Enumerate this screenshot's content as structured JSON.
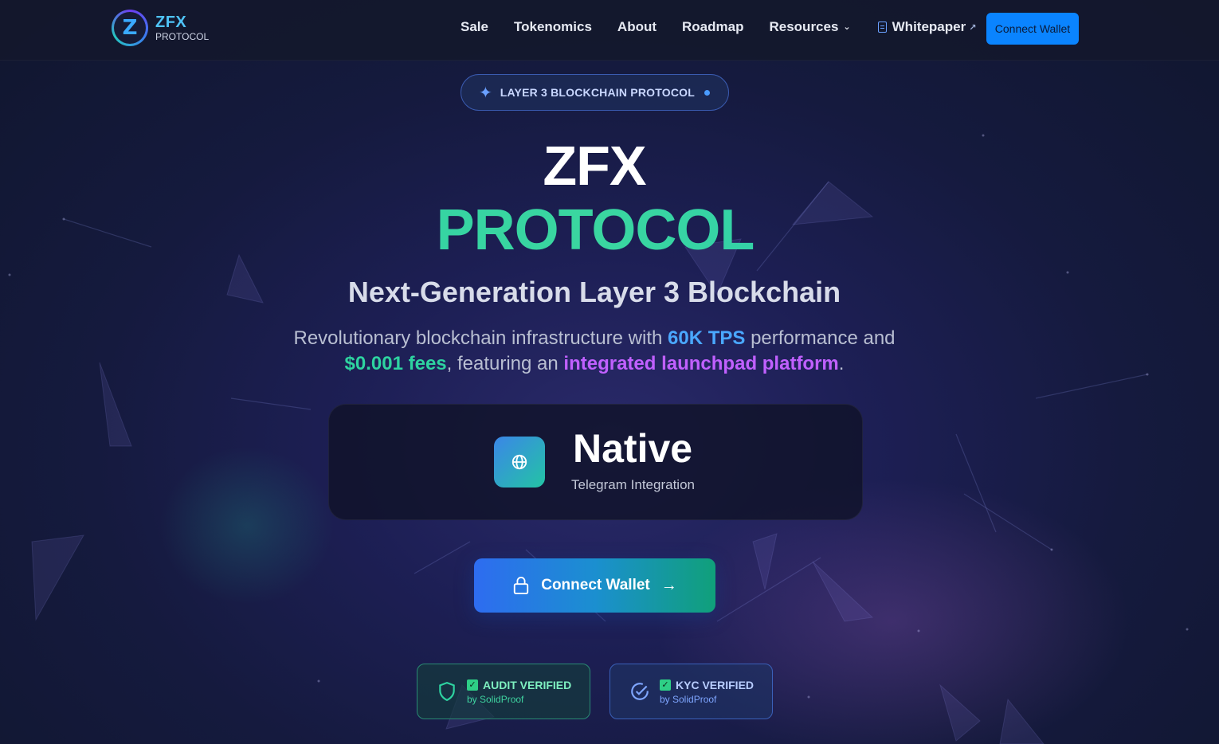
{
  "nav": {
    "logo_title": "ZFX",
    "logo_subtitle": "PROTOCOL",
    "logo_letter": "Z",
    "links": [
      "Sale",
      "Tokenomics",
      "About",
      "Roadmap",
      "Resources"
    ],
    "whitepaper_label": "Whitepaper",
    "connect_label": "Connect Wallet"
  },
  "badge": {
    "label": "LAYER 3 BLOCKCHAIN PROTOCOL"
  },
  "hero": {
    "title_line1": "ZFX",
    "title_line2": "PROTOCOL",
    "subtitle": "Next-Generation Layer 3 Blockchain",
    "desc_part1": "Revolutionary blockchain infrastructure with ",
    "desc_tps": "60K TPS",
    "desc_part2": " performance and ",
    "desc_fees": "$0.001 fees",
    "desc_part3": ", featuring an ",
    "desc_launchpad": "integrated launchpad platform",
    "desc_part4": "."
  },
  "feature": {
    "title": "Native",
    "subtitle": "Telegram Integration"
  },
  "cta": {
    "label": "Connect Wallet"
  },
  "verify": {
    "audit_title": "AUDIT VERIFIED",
    "audit_sub": "by SolidProof",
    "kyc_title": "KYC VERIFIED",
    "kyc_sub": "by SolidProof"
  },
  "colors": {
    "accent_blue": "#0a84ff",
    "accent_green": "#2ed3a0",
    "accent_purple": "#c060ff",
    "background": "#151a3e"
  },
  "icons": {
    "badge": "sparkles-icon",
    "feature": "globe-icon",
    "cta_left": "lock-icon",
    "cta_right": "arrow-right-icon",
    "audit": "shield-icon",
    "kyc": "check-circle-icon"
  }
}
